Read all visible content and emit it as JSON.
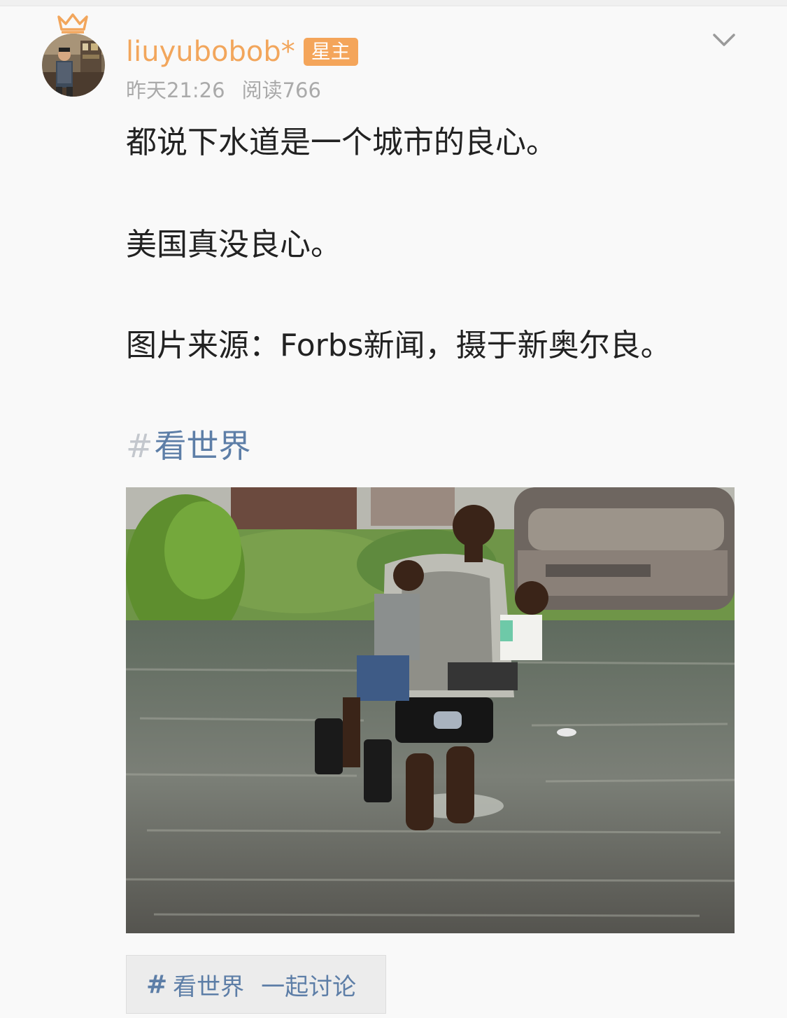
{
  "post": {
    "author": {
      "name": "liuyubobob*",
      "badge": "星主",
      "avatar": "avatar-photo"
    },
    "meta": {
      "time": "昨天21:26",
      "reads": "阅读766"
    },
    "icons": {
      "crown": "crown-icon",
      "more": "chevron-down-icon",
      "hash": "hash-icon"
    },
    "paragraphs": [
      "都说下水道是一个城市的良心。",
      "美国真没良心。",
      "图片来源：Forbs新闻，摄于新奥尔良。"
    ],
    "topic": {
      "hash": "#",
      "name": "看世界"
    },
    "discuss_button": {
      "hash": "#",
      "topic": "看世界",
      "action": "一起讨论"
    }
  },
  "colors": {
    "username": "#f2a65c",
    "badge_bg": "#f4a55a",
    "topic": "#5d7ea7",
    "meta": "#aaaaaa",
    "background": "#f9f9f9"
  }
}
